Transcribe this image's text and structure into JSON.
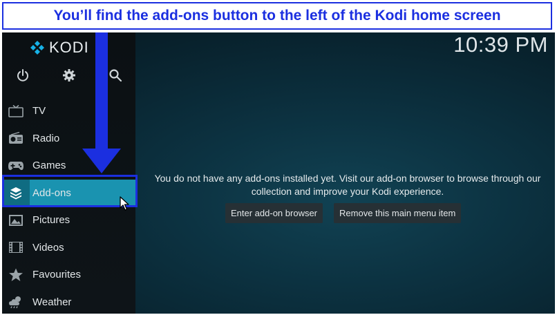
{
  "banner": {
    "text": "You’ll find the add-ons button to the left of the Kodi home screen"
  },
  "app": {
    "logo_text": "KODI",
    "clock": "10:39 PM"
  },
  "top_icons": [
    "power-icon",
    "gear-icon",
    "search-icon"
  ],
  "menu": {
    "items": [
      {
        "label": "TV",
        "icon": "tv-icon"
      },
      {
        "label": "Radio",
        "icon": "radio-icon"
      },
      {
        "label": "Games",
        "icon": "gamepad-icon"
      },
      {
        "label": "Add-ons",
        "icon": "addons-box-icon",
        "active": true
      },
      {
        "label": "Pictures",
        "icon": "pictures-icon"
      },
      {
        "label": "Videos",
        "icon": "film-icon"
      },
      {
        "label": "Favourites",
        "icon": "star-icon"
      },
      {
        "label": "Weather",
        "icon": "weather-icon"
      }
    ]
  },
  "main": {
    "message": "You do not have any add-ons installed yet. Visit our add-on browser to browse through our collection and improve your Kodi experience.",
    "buttons": {
      "browser": "Enter add-on browser",
      "remove": "Remove this main menu item"
    }
  },
  "colors": {
    "accent_blue": "#1b2fe0",
    "active_item": "#1a93b0"
  }
}
